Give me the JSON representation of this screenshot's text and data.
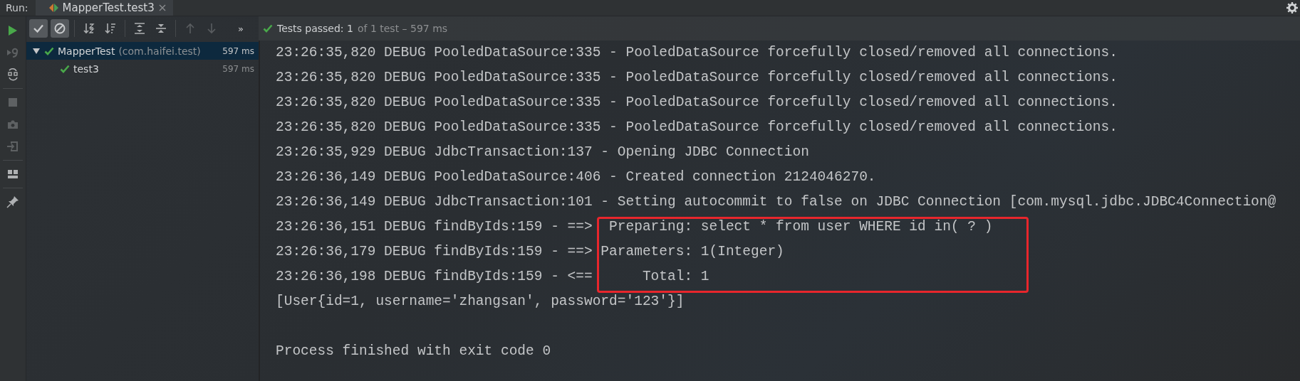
{
  "tool_window": {
    "label": "Run:",
    "tabs": [
      {
        "title": "MapperTest.test3",
        "selected": true
      }
    ]
  },
  "side_toolbar": [
    {
      "kind": "run",
      "disabled": false
    },
    {
      "kind": "rerun-failed",
      "disabled": true
    },
    {
      "kind": "auto-test",
      "disabled": false
    },
    {
      "kind": "stop",
      "disabled": true
    },
    {
      "kind": "camera",
      "disabled": true
    },
    {
      "kind": "import",
      "disabled": true
    },
    {
      "kind": "layout",
      "disabled": false
    },
    {
      "kind": "pin",
      "disabled": false
    }
  ],
  "toolbar": {
    "buttons": [
      {
        "kind": "show-passed",
        "pressed": true,
        "disabled": false
      },
      {
        "kind": "show-ignored",
        "pressed": true,
        "disabled": false
      },
      {
        "kind": "sort-alpha",
        "pressed": false,
        "disabled": false
      },
      {
        "kind": "sort-duration",
        "pressed": false,
        "disabled": false
      },
      {
        "kind": "expand-all",
        "pressed": false,
        "disabled": false
      },
      {
        "kind": "collapse-all",
        "pressed": false,
        "disabled": false
      },
      {
        "kind": "previous",
        "pressed": false,
        "disabled": true
      },
      {
        "kind": "next",
        "pressed": false,
        "disabled": true
      }
    ],
    "overflow": "»"
  },
  "status": {
    "label": "Tests passed: 1",
    "detail": "of 1 test – 597 ms"
  },
  "tree": [
    {
      "name": "MapperTest",
      "package": "(com.haifei.test)",
      "time": "597 ms",
      "expanded": true,
      "selected": true,
      "children": [
        {
          "name": "test3",
          "time": "597 ms",
          "selected": false
        }
      ]
    }
  ],
  "console": {
    "lines": [
      {
        "text": "23:26:35,820 DEBUG PooledDataSource:335 - PooledDataSource forcefully closed/removed all connections.",
        "highlighted": false
      },
      {
        "text": "23:26:35,820 DEBUG PooledDataSource:335 - PooledDataSource forcefully closed/removed all connections.",
        "highlighted": false
      },
      {
        "text": "23:26:35,820 DEBUG PooledDataSource:335 - PooledDataSource forcefully closed/removed all connections.",
        "highlighted": false
      },
      {
        "text": "23:26:35,820 DEBUG PooledDataSource:335 - PooledDataSource forcefully closed/removed all connections.",
        "highlighted": false
      },
      {
        "text": "23:26:35,929 DEBUG JdbcTransaction:137 - Opening JDBC Connection",
        "highlighted": false
      },
      {
        "text": "23:26:36,149 DEBUG PooledDataSource:406 - Created connection 2124046270.",
        "highlighted": false
      },
      {
        "text": "23:26:36,149 DEBUG JdbcTransaction:101 - Setting autocommit to false on JDBC Connection [com.mysql.jdbc.JDBC4Connection@",
        "highlighted": false
      },
      {
        "text": "23:26:36,151 DEBUG findByIds:159 - ==>  Preparing: select * from user WHERE id in( ? )",
        "highlighted": true
      },
      {
        "text": "23:26:36,179 DEBUG findByIds:159 - ==> Parameters: 1(Integer)",
        "highlighted": true
      },
      {
        "text": "23:26:36,198 DEBUG findByIds:159 - <==      Total: 1",
        "highlighted": true
      },
      {
        "text": "[User{id=1, username='zhangsan', password='123'}]",
        "highlighted": false
      },
      {
        "text": "Process finished with exit code 0",
        "highlighted": false,
        "kind": "exit"
      }
    ]
  }
}
